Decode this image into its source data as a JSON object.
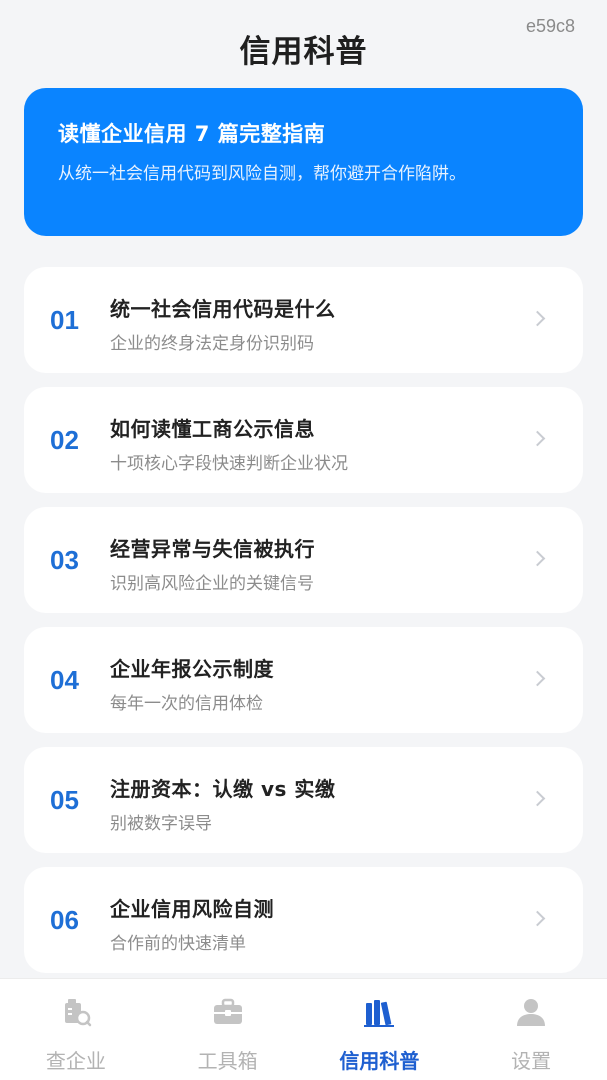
{
  "header": {
    "title": "信用科普",
    "code": "e59c8"
  },
  "banner": {
    "title": "读懂企业信用 7 篇完整指南",
    "subtitle": "从统一社会信用代码到风险自测，帮你避开合作陷阱。"
  },
  "articles": [
    {
      "num": "01",
      "title": "统一社会信用代码是什么",
      "subtitle": "企业的终身法定身份识别码"
    },
    {
      "num": "02",
      "title": "如何读懂工商公示信息",
      "subtitle": "十项核心字段快速判断企业状况"
    },
    {
      "num": "03",
      "title": "经营异常与失信被执行",
      "subtitle": "识别高风险企业的关键信号"
    },
    {
      "num": "04",
      "title": "企业年报公示制度",
      "subtitle": "每年一次的信用体检"
    },
    {
      "num": "05",
      "title": "注册资本：认缴 vs 实缴",
      "subtitle": "别被数字误导"
    },
    {
      "num": "06",
      "title": "企业信用风险自测",
      "subtitle": "合作前的快速清单"
    }
  ],
  "tabbar": {
    "active": "信用科普",
    "items": [
      {
        "label": "查企业",
        "icon": "company-search-icon"
      },
      {
        "label": "工具箱",
        "icon": "toolbox-icon"
      },
      {
        "label": "信用科普",
        "icon": "books-icon"
      },
      {
        "label": "设置",
        "icon": "user-icon"
      }
    ]
  },
  "colors": {
    "accent": "#0a84ff",
    "number": "#1e6fd6",
    "active_tab": "#1e5fd0",
    "inactive_tab": "#b3b3b3"
  }
}
